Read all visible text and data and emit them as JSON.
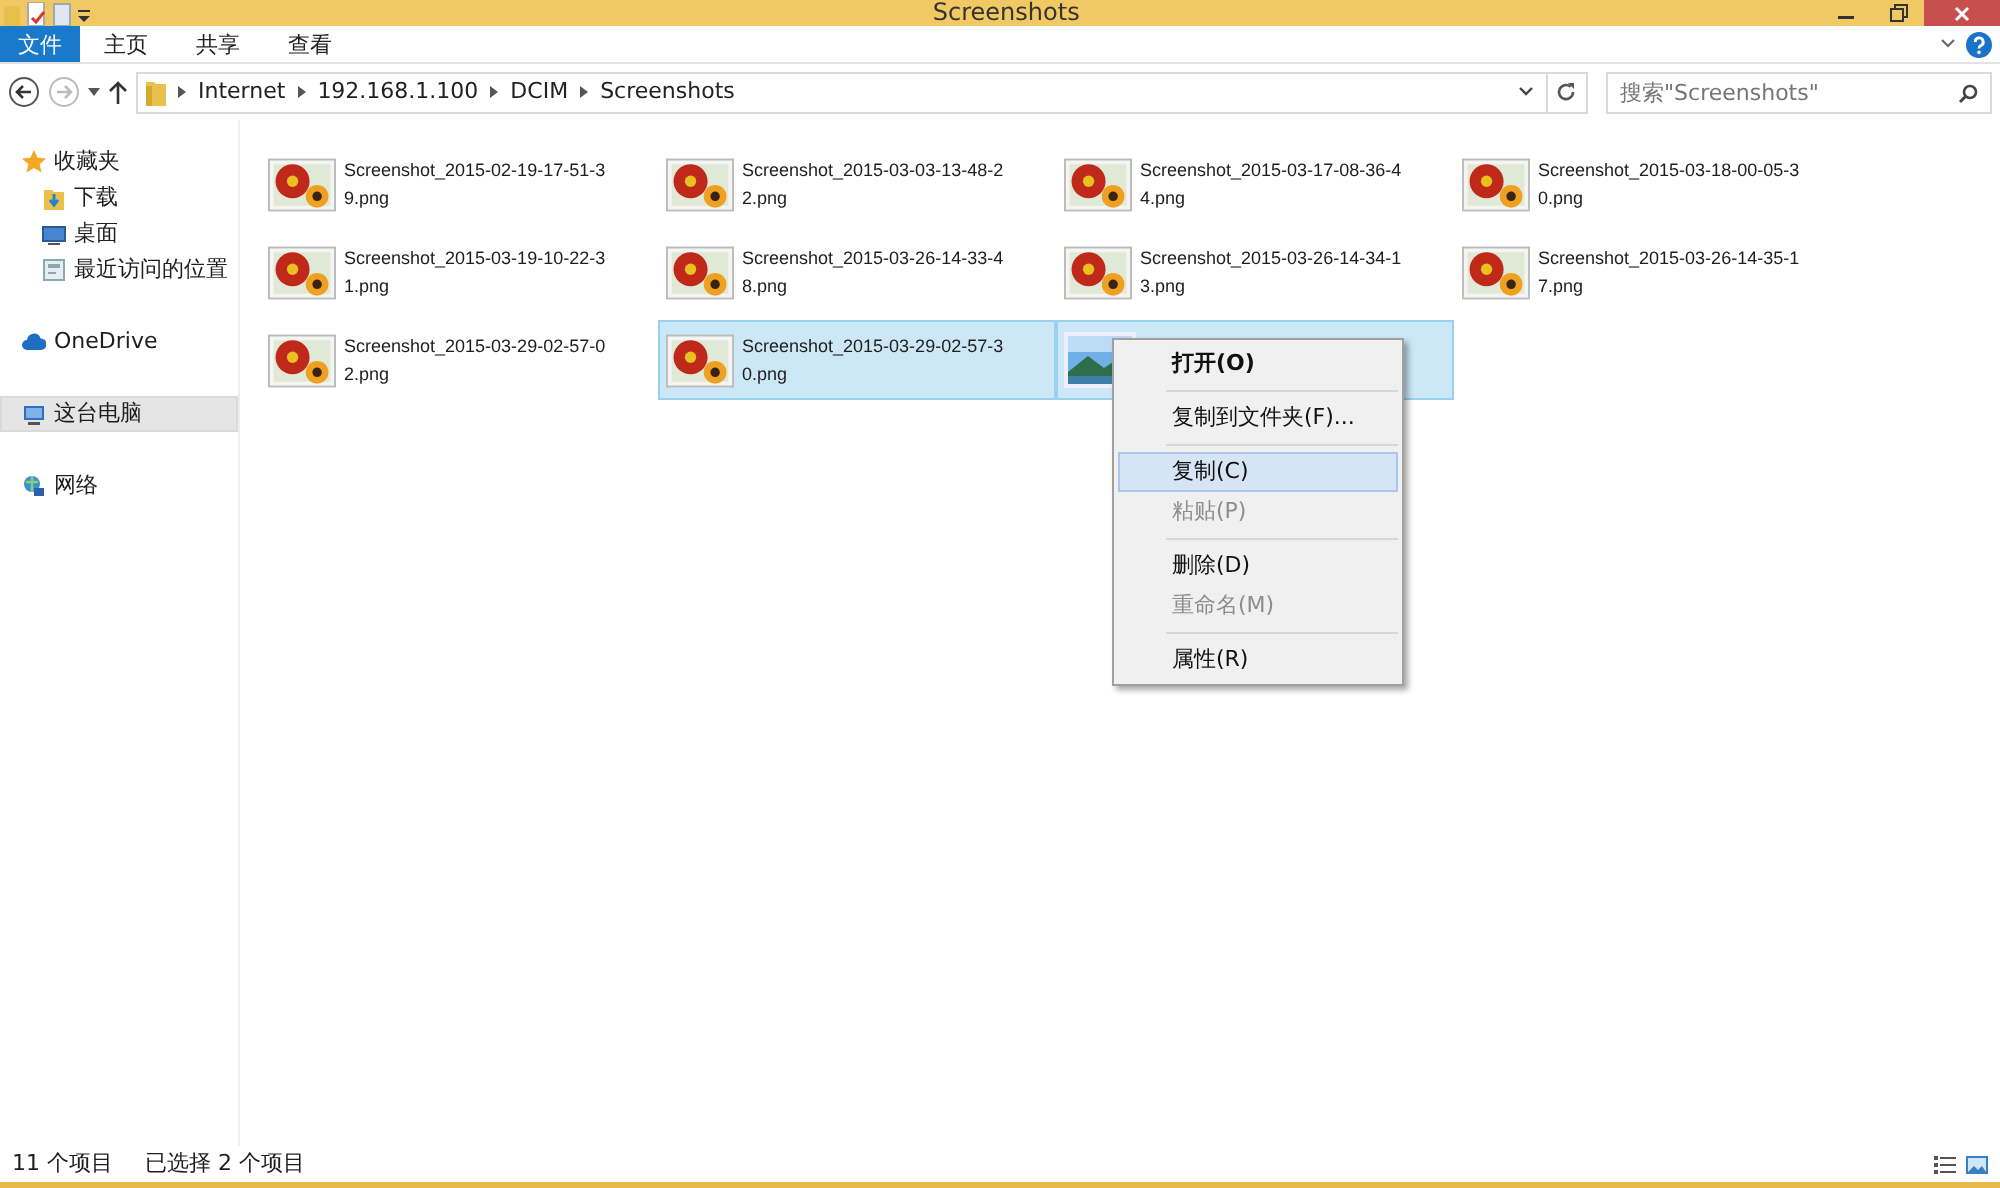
{
  "window": {
    "title": "Screenshots"
  },
  "ribbon_tabs": [
    {
      "label": "文件",
      "kind": "file"
    },
    {
      "label": "主页",
      "kind": "tab"
    },
    {
      "label": "共享",
      "kind": "tab"
    },
    {
      "label": "查看",
      "kind": "tab"
    }
  ],
  "address_bar": {
    "crumbs": [
      "Internet",
      "192.168.1.100",
      "DCIM",
      "Screenshots"
    ]
  },
  "search": {
    "placeholder": "搜索\"Screenshots\""
  },
  "sidebar": {
    "items": [
      {
        "label": "收藏夹",
        "selected": false,
        "children": [
          {
            "label": "下载",
            "selected": false
          },
          {
            "label": "桌面",
            "selected": false
          },
          {
            "label": "最近访问的位置",
            "selected": false
          }
        ]
      },
      {
        "label": "OneDrive",
        "selected": false
      },
      {
        "label": "这台电脑",
        "selected": true
      },
      {
        "label": "网络",
        "selected": false
      }
    ]
  },
  "files": [
    {
      "name": "Screenshot_2015-02-19-17-51-3\n9.png",
      "kind": "flower",
      "selected": false
    },
    {
      "name": "Screenshot_2015-03-03-13-48-2\n2.png",
      "kind": "flower",
      "selected": false
    },
    {
      "name": "Screenshot_2015-03-17-08-36-4\n4.png",
      "kind": "flower",
      "selected": false
    },
    {
      "name": "Screenshot_2015-03-18-00-05-3\n0.png",
      "kind": "flower",
      "selected": false
    },
    {
      "name": "Screenshot_2015-03-19-10-22-3\n1.png",
      "kind": "flower",
      "selected": false
    },
    {
      "name": "Screenshot_2015-03-26-14-33-4\n8.png",
      "kind": "flower",
      "selected": false
    },
    {
      "name": "Screenshot_2015-03-26-14-34-1\n3.png",
      "kind": "flower",
      "selected": false
    },
    {
      "name": "Screenshot_2015-03-26-14-35-1\n7.png",
      "kind": "flower",
      "selected": false
    },
    {
      "name": "Screenshot_2015-03-29-02-57-0\n2.png",
      "kind": "flower",
      "selected": false
    },
    {
      "name": "Screenshot_2015-03-29-02-57-3\n0.png",
      "kind": "flower",
      "selected": true
    },
    {
      "kind": "landscape",
      "selected": true
    }
  ],
  "context_menu": [
    {
      "kind": "item",
      "label": "打开(O)",
      "bold": true,
      "disabled": false,
      "selected": false
    },
    {
      "kind": "separator"
    },
    {
      "kind": "item",
      "label": "复制到文件夹(F)...",
      "bold": false,
      "disabled": false,
      "selected": false
    },
    {
      "kind": "separator"
    },
    {
      "kind": "item",
      "label": "复制(C)",
      "bold": false,
      "disabled": false,
      "selected": true
    },
    {
      "kind": "item",
      "label": "粘贴(P)",
      "bold": false,
      "disabled": true,
      "selected": false
    },
    {
      "kind": "separator"
    },
    {
      "kind": "item",
      "label": "删除(D)",
      "bold": false,
      "disabled": false,
      "selected": false
    },
    {
      "kind": "item",
      "label": "重命名(M)",
      "bold": false,
      "disabled": true,
      "selected": false
    },
    {
      "kind": "separator"
    },
    {
      "kind": "item",
      "label": "属性(R)",
      "bold": false,
      "disabled": false,
      "selected": false
    }
  ],
  "status_bar": {
    "count": "11 个项目",
    "selection": "已选择 2 个项目"
  }
}
